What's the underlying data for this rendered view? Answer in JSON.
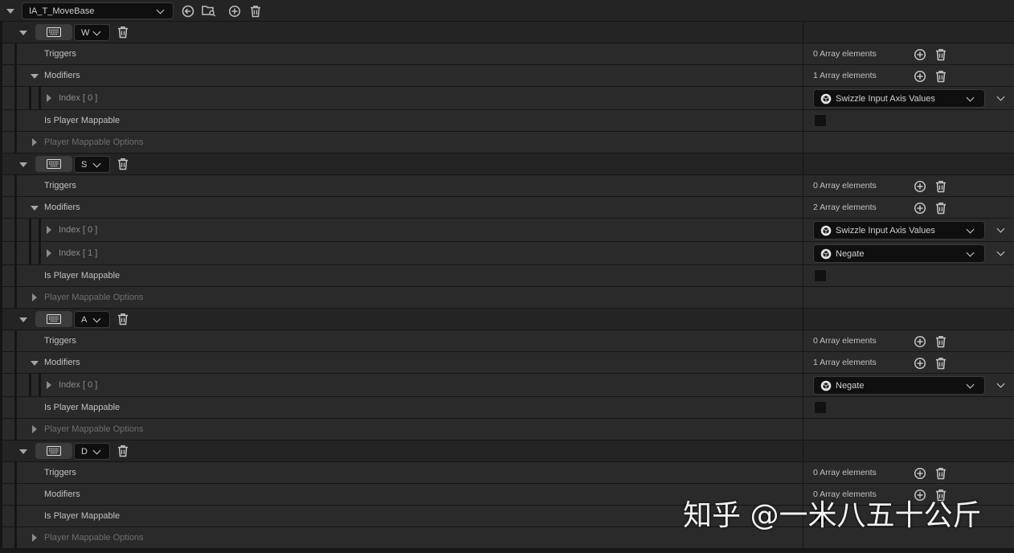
{
  "header": {
    "asset_name": "IA_T_MoveBase"
  },
  "mappings": [
    {
      "key": "W",
      "triggers": "Triggers",
      "triggers_count": "0 Array elements",
      "modifiers": "Modifiers",
      "modifiers_count": "1 Array elements",
      "modifier_items": [
        {
          "index_label": "Index [ 0 ]",
          "value": "Swizzle Input Axis Values"
        }
      ],
      "player_mappable": "Is Player Mappable",
      "mappable_options": "Player Mappable Options"
    },
    {
      "key": "S",
      "triggers": "Triggers",
      "triggers_count": "0 Array elements",
      "modifiers": "Modifiers",
      "modifiers_count": "2 Array elements",
      "modifier_items": [
        {
          "index_label": "Index [ 0 ]",
          "value": "Swizzle Input Axis Values"
        },
        {
          "index_label": "Index [ 1 ]",
          "value": "Negate"
        }
      ],
      "player_mappable": "Is Player Mappable",
      "mappable_options": "Player Mappable Options"
    },
    {
      "key": "A",
      "triggers": "Triggers",
      "triggers_count": "0 Array elements",
      "modifiers": "Modifiers",
      "modifiers_count": "1 Array elements",
      "modifier_items": [
        {
          "index_label": "Index [ 0 ]",
          "value": "Negate"
        }
      ],
      "player_mappable": "Is Player Mappable",
      "mappable_options": "Player Mappable Options"
    },
    {
      "key": "D",
      "triggers": "Triggers",
      "triggers_count": "0 Array elements",
      "modifiers": "Modifiers",
      "modifiers_count": "0 Array elements",
      "modifier_items": [],
      "player_mappable": "Is Player Mappable",
      "mappable_options": "Player Mappable Options"
    }
  ],
  "watermark": "知乎 @一米八五十公斤"
}
